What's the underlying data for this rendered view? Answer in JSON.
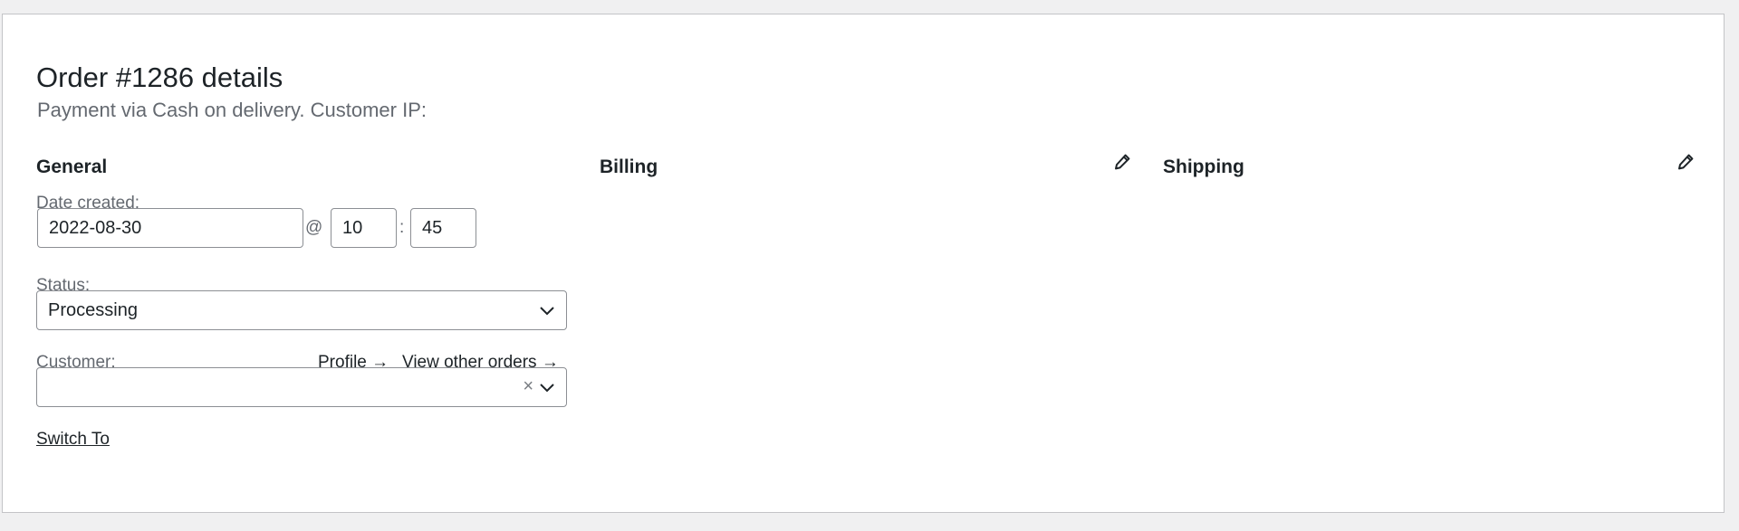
{
  "order": {
    "title": "Order #1286 details",
    "subtitle": "Payment via Cash on delivery. Customer IP:"
  },
  "columns": {
    "general": "General",
    "billing": "Billing",
    "shipping": "Shipping"
  },
  "general": {
    "date_label": "Date created:",
    "date_value": "2022-08-30",
    "at_sep": "@",
    "hour": "10",
    "colon_sep": ":",
    "minute": "45",
    "status_label": "Status:",
    "status_value": "Processing",
    "customer_label": "Customer:",
    "profile_link": "Profile →",
    "other_orders_link": "View other orders →",
    "customer_value": "",
    "clear_symbol": "×",
    "switch_to_link": "Switch To"
  },
  "icons": {
    "edit": "pencil-icon",
    "dropdown": "chevron-down-icon"
  }
}
